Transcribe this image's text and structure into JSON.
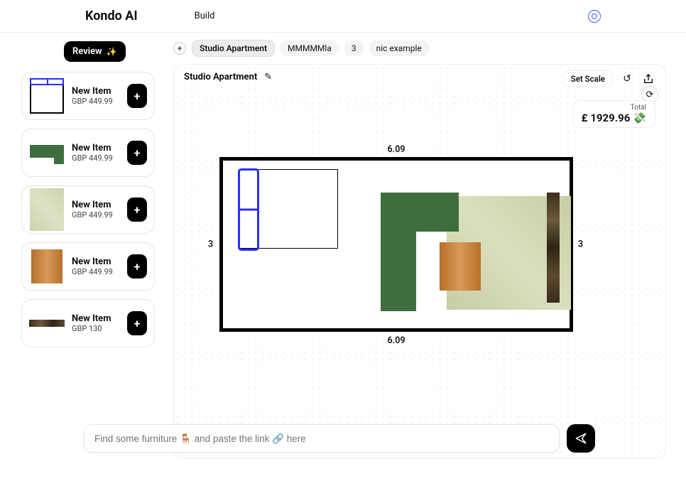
{
  "header": {
    "brand": "Kondo AI",
    "page": "Build"
  },
  "review_label": "Review",
  "items": [
    {
      "name": "New Item",
      "price": "GBP 449.99"
    },
    {
      "name": "New Item",
      "price": "GBP 449.99"
    },
    {
      "name": "New Item",
      "price": "GBP 449.99"
    },
    {
      "name": "New Item",
      "price": "GBP 449.99"
    },
    {
      "name": "New Item",
      "price": "GBP 130"
    }
  ],
  "tabs": [
    {
      "label": "Studio Apartment"
    },
    {
      "label": "MMMMMla"
    },
    {
      "label": "3"
    },
    {
      "label": "nic example"
    }
  ],
  "canvas": {
    "title": "Studio Apartment",
    "set_scale": "Set Scale",
    "total_label": "Total",
    "total_value": "£ 1929.96",
    "room": {
      "dim_top": "6.09",
      "dim_bottom": "6.09",
      "dim_left": "3",
      "dim_right": "3"
    }
  },
  "input": {
    "placeholder": "Find some furniture 🪑 and paste the link 🔗 here"
  },
  "plus": "+",
  "money_emoji": "💸"
}
